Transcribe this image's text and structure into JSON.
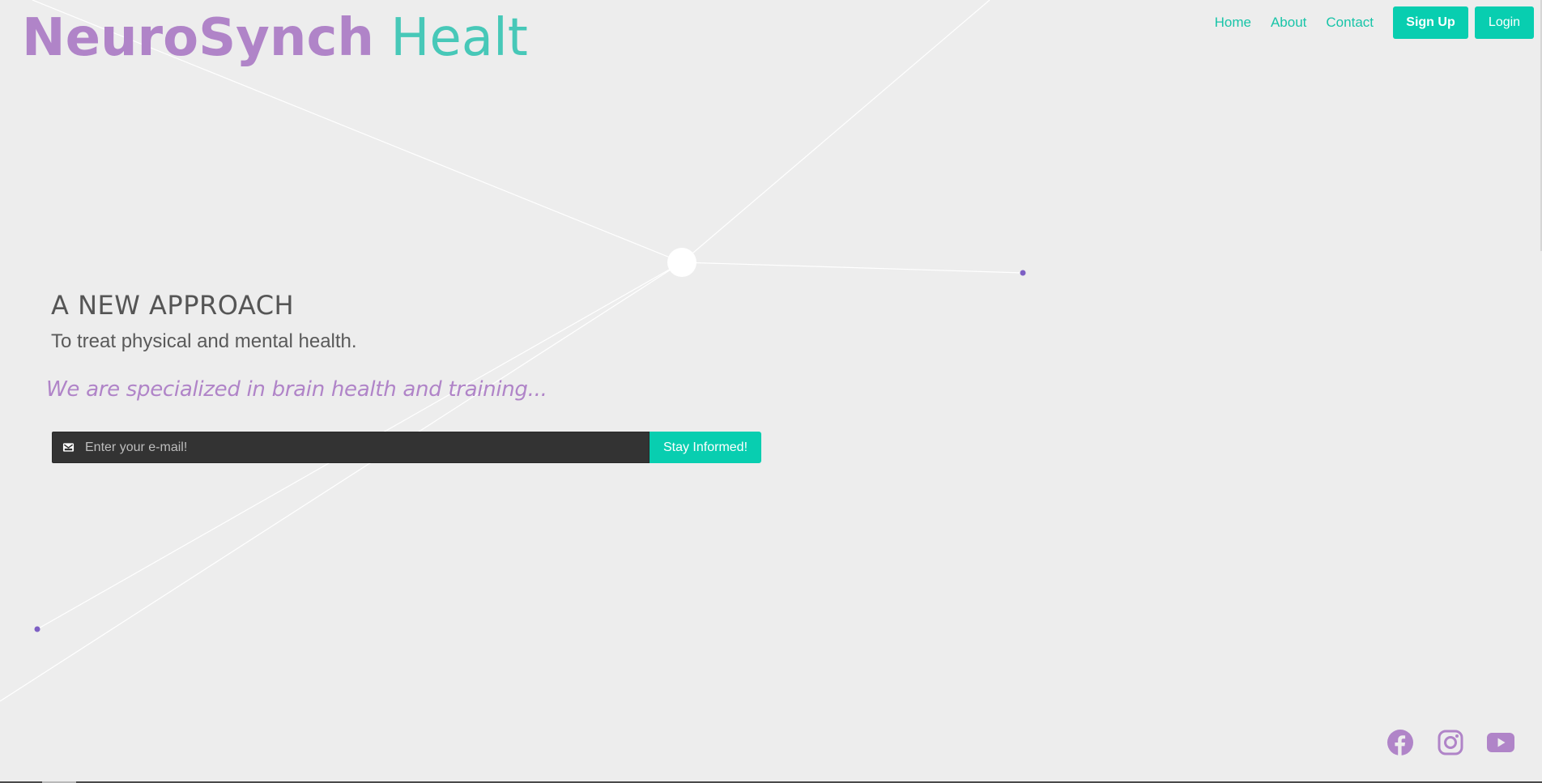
{
  "logo": {
    "primary": "NeuroSynch",
    "secondary": "Healt"
  },
  "nav": {
    "links": [
      "Home",
      "About",
      "Contact"
    ],
    "signup_label": "Sign Up",
    "login_label": "Login"
  },
  "hero": {
    "heading": "A NEW APPROACH",
    "subheading": "To treat physical and mental health.",
    "tagline": "We are specialized in brain health and training..."
  },
  "subscribe": {
    "icon": "envelope-icon",
    "placeholder": "Enter your e-mail!",
    "button_label": "Stay Informed!"
  },
  "social": {
    "icons": [
      "facebook-icon",
      "instagram-icon",
      "youtube-icon"
    ]
  },
  "colors": {
    "background": "#ededed",
    "brand_purple": "#b084c8",
    "brand_teal": "#47c8b8",
    "accent_button": "#08ceb0",
    "node_dot": "#7d5fc4",
    "input_bg": "#333333"
  }
}
